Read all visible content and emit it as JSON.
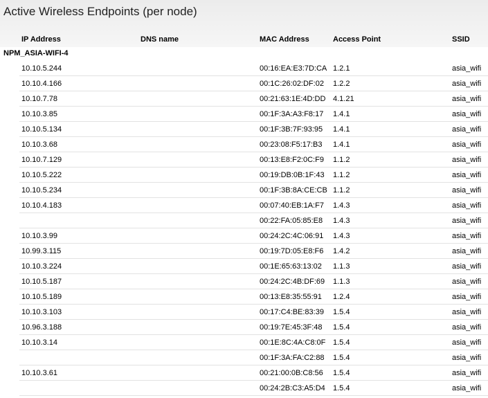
{
  "title": "Active Wireless Endpoints (per node)",
  "columns": {
    "ip": "IP Address",
    "dns": "DNS name",
    "mac": "MAC Address",
    "ap": "Access Point",
    "ssid": "SSID"
  },
  "group": "NPM_ASIA-WIFI-4",
  "rows": [
    {
      "ip": "10.10.5.244",
      "dns": "",
      "mac": "00:16:EA:E3:7D:CA",
      "ap": "1.2.1",
      "ssid": "asia_wifi"
    },
    {
      "ip": "10.10.4.166",
      "dns": "",
      "mac": "00:1C:26:02:DF:02",
      "ap": "1.2.2",
      "ssid": "asia_wifi"
    },
    {
      "ip": "10.10.7.78",
      "dns": "",
      "mac": "00:21:63:1E:4D:DD",
      "ap": "4.1.21",
      "ssid": "asia_wifi"
    },
    {
      "ip": "10.10.3.85",
      "dns": "",
      "mac": "00:1F:3A:A3:F8:17",
      "ap": "1.4.1",
      "ssid": "asia_wifi"
    },
    {
      "ip": "10.10.5.134",
      "dns": "",
      "mac": "00:1F:3B:7F:93:95",
      "ap": "1.4.1",
      "ssid": "asia_wifi"
    },
    {
      "ip": "10.10.3.68",
      "dns": "",
      "mac": "00:23:08:F5:17:B3",
      "ap": "1.4.1",
      "ssid": "asia_wifi"
    },
    {
      "ip": "10.10.7.129",
      "dns": "",
      "mac": "00:13:E8:F2:0C:F9",
      "ap": "1.1.2",
      "ssid": "asia_wifi"
    },
    {
      "ip": "10.10.5.222",
      "dns": "",
      "mac": "00:19:DB:0B:1F:43",
      "ap": "1.1.2",
      "ssid": "asia_wifi"
    },
    {
      "ip": "10.10.5.234",
      "dns": "",
      "mac": "00:1F:3B:8A:CE:CB",
      "ap": "1.1.2",
      "ssid": "asia_wifi"
    },
    {
      "ip": "10.10.4.183",
      "dns": "",
      "mac": "00:07:40:EB:1A:F7",
      "ap": "1.4.3",
      "ssid": "asia_wifi"
    },
    {
      "ip": "",
      "dns": "",
      "mac": "00:22:FA:05:85:E8",
      "ap": "1.4.3",
      "ssid": "asia_wifi"
    },
    {
      "ip": "10.10.3.99",
      "dns": "",
      "mac": "00:24:2C:4C:06:91",
      "ap": "1.4.3",
      "ssid": "asia_wifi"
    },
    {
      "ip": "10.99.3.115",
      "dns": "",
      "mac": "00:19:7D:05:E8:F6",
      "ap": "1.4.2",
      "ssid": "asia_wifi"
    },
    {
      "ip": "10.10.3.224",
      "dns": "",
      "mac": "00:1E:65:63:13:02",
      "ap": "1.1.3",
      "ssid": "asia_wifi"
    },
    {
      "ip": "10.10.5.187",
      "dns": "",
      "mac": "00:24:2C:4B:DF:69",
      "ap": "1.1.3",
      "ssid": "asia_wifi"
    },
    {
      "ip": "10.10.5.189",
      "dns": "",
      "mac": "00:13:E8:35:55:91",
      "ap": "1.2.4",
      "ssid": "asia_wifi"
    },
    {
      "ip": "10.10.3.103",
      "dns": "",
      "mac": "00:17:C4:BE:83:39",
      "ap": "1.5.4",
      "ssid": "asia_wifi"
    },
    {
      "ip": "10.96.3.188",
      "dns": "",
      "mac": "00:19:7E:45:3F:48",
      "ap": "1.5.4",
      "ssid": "asia_wifi"
    },
    {
      "ip": "10.10.3.14",
      "dns": "",
      "mac": "00:1E:8C:4A:C8:0F",
      "ap": "1.5.4",
      "ssid": "asia_wifi"
    },
    {
      "ip": "",
      "dns": "",
      "mac": "00:1F:3A:FA:C2:88",
      "ap": "1.5.4",
      "ssid": "asia_wifi"
    },
    {
      "ip": "10.10.3.61",
      "dns": "",
      "mac": "00:21:00:0B:C8:56",
      "ap": "1.5.4",
      "ssid": "asia_wifi"
    },
    {
      "ip": "",
      "dns": "",
      "mac": "00:24:2B:C3:A5:D4",
      "ap": "1.5.4",
      "ssid": "asia_wifi"
    }
  ]
}
